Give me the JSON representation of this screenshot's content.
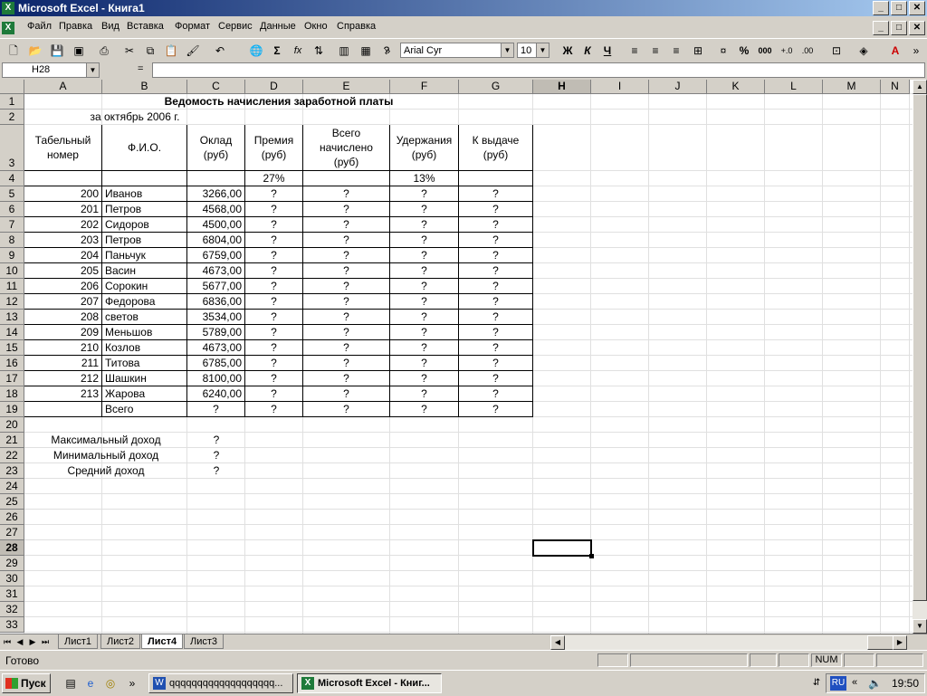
{
  "window": {
    "title": "Microsoft Excel - Книга1",
    "app_icon": "excel-icon",
    "min": "_",
    "max": "□",
    "close": "✕"
  },
  "menu": [
    "Файл",
    "Правка",
    "Вид",
    "Вставка",
    "Формат",
    "Сервис",
    "Данные",
    "Окно",
    "Справка"
  ],
  "toolbar": {
    "font_name": "Arial Cyr",
    "font_size": "10",
    "bold": "Ж",
    "italic": "К",
    "underline": "Ч",
    "sum": "Σ",
    "fx": "fx",
    "percent": "%",
    "thousands": "000",
    "more": "»"
  },
  "formula_bar": {
    "name_box": "H28",
    "eq": "=",
    "content": ""
  },
  "grid": {
    "columns": [
      "A",
      "B",
      "C",
      "D",
      "E",
      "F",
      "G",
      "H",
      "I",
      "J",
      "K",
      "L",
      "M",
      "N"
    ],
    "selected_column": "H",
    "rows": [
      "1",
      "2",
      "3",
      "4",
      "5",
      "6",
      "7",
      "8",
      "9",
      "10",
      "11",
      "12",
      "13",
      "14",
      "15",
      "16",
      "17",
      "18",
      "19",
      "20",
      "21",
      "22",
      "23",
      "24",
      "25",
      "26",
      "27",
      "28",
      "29",
      "30",
      "31",
      "32",
      "33"
    ],
    "selected_row": "28",
    "active_cell": "H28"
  },
  "sheet": {
    "title": "Ведомость начисления заработной платы",
    "subtitle": "за октябрь 2006 г.",
    "headers": [
      "Табельный номер",
      "Ф.И.О.",
      "Оклад (руб)",
      "Премия (руб)",
      "Всего начислено (руб)",
      "Удержания (руб)",
      "К выдаче (руб)"
    ],
    "bonus_pct": "27%",
    "deduction_pct": "13%",
    "employees": [
      {
        "id": "200",
        "name": "Иванов",
        "salary": "3266,00",
        "bonus": "?",
        "total": "?",
        "deduct": "?",
        "payout": "?"
      },
      {
        "id": "201",
        "name": "Петров",
        "salary": "4568,00",
        "bonus": "?",
        "total": "?",
        "deduct": "?",
        "payout": "?"
      },
      {
        "id": "202",
        "name": "Сидоров",
        "salary": "4500,00",
        "bonus": "?",
        "total": "?",
        "deduct": "?",
        "payout": "?"
      },
      {
        "id": "203",
        "name": "Петров",
        "salary": "6804,00",
        "bonus": "?",
        "total": "?",
        "deduct": "?",
        "payout": "?"
      },
      {
        "id": "204",
        "name": "Паньчук",
        "salary": "6759,00",
        "bonus": "?",
        "total": "?",
        "deduct": "?",
        "payout": "?"
      },
      {
        "id": "205",
        "name": "Васин",
        "salary": "4673,00",
        "bonus": "?",
        "total": "?",
        "deduct": "?",
        "payout": "?"
      },
      {
        "id": "206",
        "name": "Сорокин",
        "salary": "5677,00",
        "bonus": "?",
        "total": "?",
        "deduct": "?",
        "payout": "?"
      },
      {
        "id": "207",
        "name": "Федорова",
        "salary": "6836,00",
        "bonus": "?",
        "total": "?",
        "deduct": "?",
        "payout": "?"
      },
      {
        "id": "208",
        "name": "светов",
        "salary": "3534,00",
        "bonus": "?",
        "total": "?",
        "deduct": "?",
        "payout": "?"
      },
      {
        "id": "209",
        "name": "Меньшов",
        "salary": "5789,00",
        "bonus": "?",
        "total": "?",
        "deduct": "?",
        "payout": "?"
      },
      {
        "id": "210",
        "name": "Козлов",
        "salary": "4673,00",
        "bonus": "?",
        "total": "?",
        "deduct": "?",
        "payout": "?"
      },
      {
        "id": "211",
        "name": "Титова",
        "salary": "6785,00",
        "bonus": "?",
        "total": "?",
        "deduct": "?",
        "payout": "?"
      },
      {
        "id": "212",
        "name": "Шашкин",
        "salary": "8100,00",
        "bonus": "?",
        "total": "?",
        "deduct": "?",
        "payout": "?"
      },
      {
        "id": "213",
        "name": "Жарова",
        "salary": "6240,00",
        "bonus": "?",
        "total": "?",
        "deduct": "?",
        "payout": "?"
      }
    ],
    "totals": {
      "label": "Всего",
      "salary": "?",
      "bonus": "?",
      "total": "?",
      "deduct": "?",
      "payout": "?"
    },
    "stats": [
      {
        "label": "Максимальный доход",
        "value": "?"
      },
      {
        "label": "Минимальный доход",
        "value": "?"
      },
      {
        "label": "Средний доход",
        "value": "?"
      }
    ]
  },
  "tabs": [
    "Лист1",
    "Лист2",
    "Лист4",
    "Лист3"
  ],
  "active_tab": "Лист4",
  "status": {
    "text": "Готово",
    "num": "NUM"
  },
  "taskbar": {
    "start": "Пуск",
    "more": "»",
    "items": [
      {
        "label": "qqqqqqqqqqqqqqqqqqq...",
        "icon": "word-icon",
        "active": false
      },
      {
        "label": "Microsoft Excel - Книг...",
        "icon": "excel-icon",
        "active": true
      }
    ],
    "lang": "RU",
    "expand": "«",
    "clock": "19:50"
  }
}
